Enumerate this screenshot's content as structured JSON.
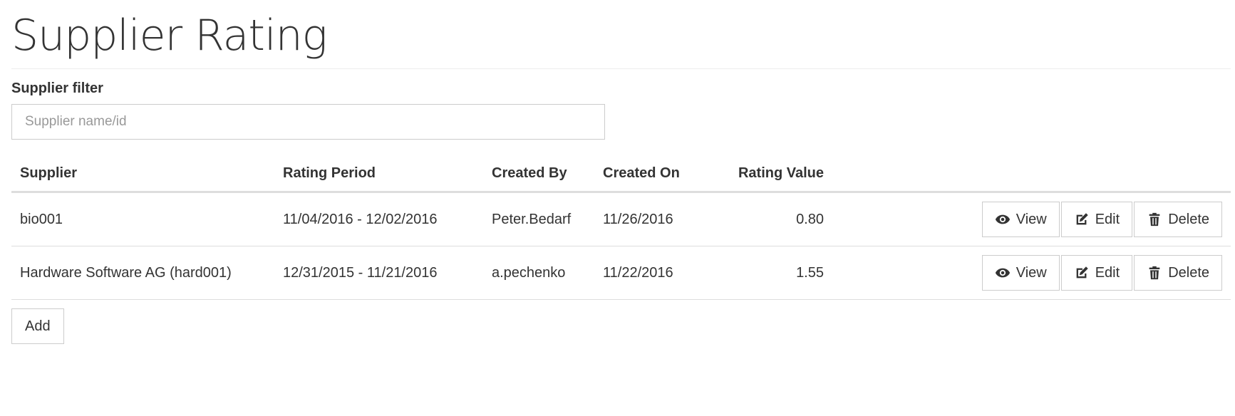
{
  "page": {
    "title": "Supplier Rating"
  },
  "filter": {
    "label": "Supplier filter",
    "placeholder": "Supplier name/id",
    "value": ""
  },
  "table": {
    "columns": {
      "supplier": "Supplier",
      "rating_period": "Rating Period",
      "created_by": "Created By",
      "created_on": "Created On",
      "rating_value": "Rating Value"
    },
    "rows": [
      {
        "supplier": "bio001",
        "rating_period": "11/04/2016 - 12/02/2016",
        "created_by": "Peter.Bedarf",
        "created_on": "11/26/2016",
        "rating_value": "0.80"
      },
      {
        "supplier": "Hardware Software AG (hard001)",
        "rating_period": "12/31/2015 - 11/21/2016",
        "created_by": "a.pechenko",
        "created_on": "11/22/2016",
        "rating_value": "1.55"
      }
    ],
    "actions": {
      "view": "View",
      "edit": "Edit",
      "delete": "Delete"
    },
    "icons": {
      "view": "eye-icon",
      "edit": "edit-icon",
      "delete": "trash-icon"
    }
  },
  "add_button": {
    "label": "Add"
  }
}
